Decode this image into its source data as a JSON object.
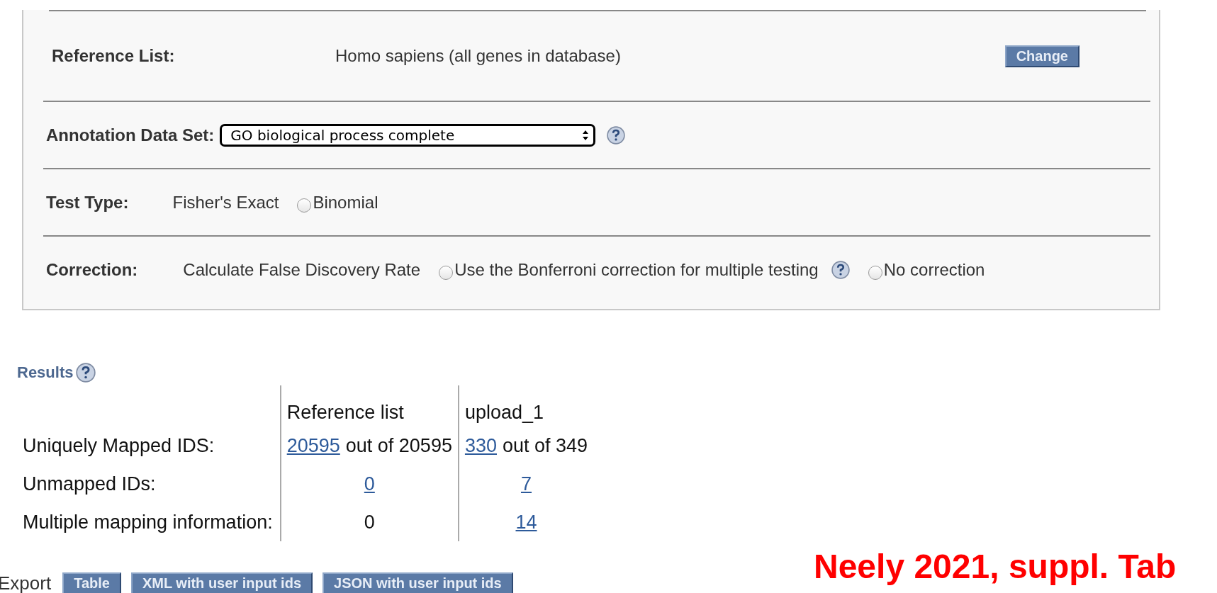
{
  "settings": {
    "reference_list": {
      "label": "Reference List:",
      "value": "Homo sapiens (all genes in database)",
      "button": "Change"
    },
    "annotation_data_set": {
      "label": "Annotation Data Set:",
      "value": "GO biological process complete"
    },
    "test_type": {
      "label": "Test Type:",
      "options": [
        {
          "label": "Fisher's Exact",
          "selected": true
        },
        {
          "label": "Binomial",
          "selected": false
        }
      ]
    },
    "correction": {
      "label": "Correction:",
      "options": [
        {
          "kind": "radio",
          "label": "Calculate False Discovery Rate",
          "selected": true
        },
        {
          "kind": "radio",
          "label": "Use the Bonferroni correction for multiple testing",
          "selected": false
        },
        {
          "kind": "help"
        },
        {
          "kind": "radio",
          "label": "No correction",
          "selected": false
        }
      ]
    }
  },
  "results": {
    "title": "Results",
    "columns": [
      "Reference list",
      "upload_1"
    ],
    "rows": [
      {
        "label": "Uniquely Mapped IDS:",
        "cells": [
          {
            "link": "20595",
            "text": "out of 20595"
          },
          {
            "link": "330",
            "text": "out of 349"
          }
        ]
      },
      {
        "label": "Unmapped IDs:",
        "cells": [
          {
            "link": "0"
          },
          {
            "link": "7"
          }
        ]
      },
      {
        "label": "Multiple mapping information:",
        "cells": [
          {
            "text": "0"
          },
          {
            "link": "14"
          }
        ]
      }
    ]
  },
  "export": {
    "label": "Export",
    "buttons": [
      "Table",
      "XML with user input ids",
      "JSON with user input ids"
    ]
  },
  "annotation": "Neely 2021, suppl. Tab"
}
